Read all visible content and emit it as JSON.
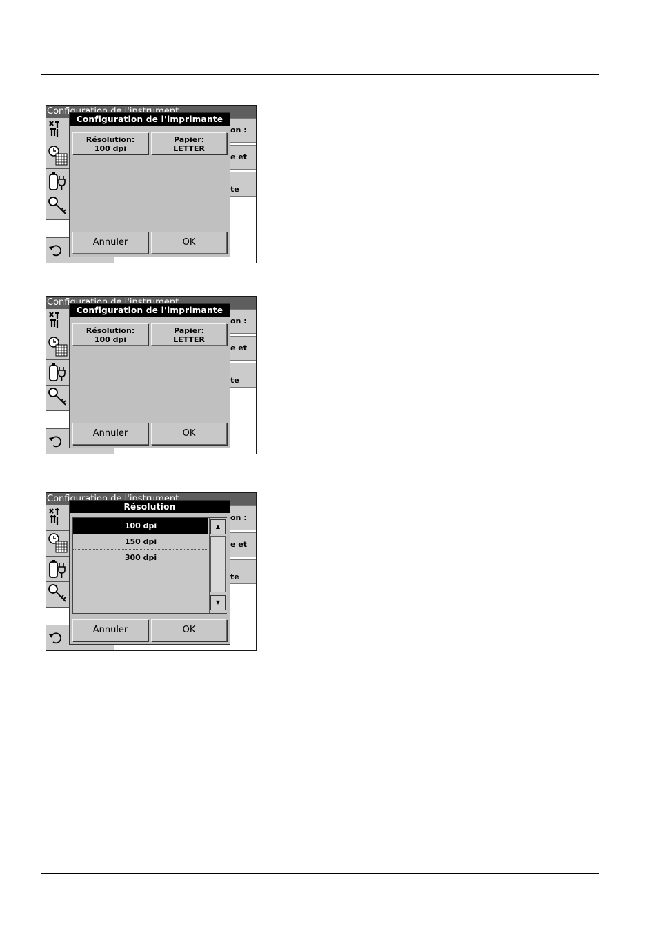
{
  "background_screen": {
    "title": "Configuration de l'instrument",
    "right_button_fragments": [
      "on :",
      "e et",
      "te"
    ]
  },
  "printer_dialog": {
    "title": "Configuration de l'imprimante",
    "resolution_label": "Résolution:",
    "resolution_value": "100 dpi",
    "paper_label": "Papier:",
    "paper_value": "LETTER",
    "cancel_label": "Annuler",
    "ok_label": "OK"
  },
  "resolution_dialog": {
    "title": "Résolution",
    "options": [
      "100 dpi",
      "150 dpi",
      "300 dpi"
    ],
    "selected": "100 dpi",
    "scroll_up_icon": "triangle-up",
    "scroll_down_icon": "triangle-down",
    "cancel_label": "Annuler",
    "ok_label": "OK"
  },
  "icons": [
    "tools-icon",
    "clock-calendar-icon",
    "battery-plug-icon",
    "key-icon",
    "back-arrow-icon"
  ],
  "colors": {
    "title_bar": "#5e5e5e",
    "dialog_title": "#000000",
    "panel": "#c0c0c0",
    "selection": "#000000"
  }
}
